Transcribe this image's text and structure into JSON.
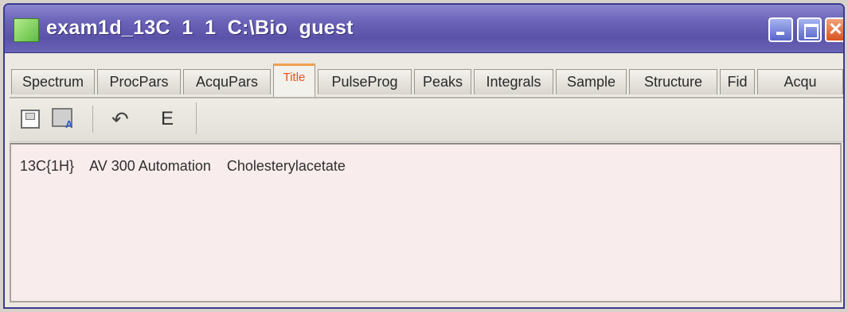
{
  "window": {
    "title": "exam1d_13C  1  1  C:\\Bio  guest",
    "buttons": {
      "minimize": "minimize-icon",
      "maximize": "maximize-icon",
      "close": "close-icon"
    },
    "colors": {
      "titlebar": "#6a63b8",
      "close": "#d8531f",
      "active_tab": "#e8531f"
    }
  },
  "tabs": [
    {
      "label": "Spectrum"
    },
    {
      "label": "ProcPars"
    },
    {
      "label": "AcquPars"
    },
    {
      "label": "Title"
    },
    {
      "label": "PulseProg"
    },
    {
      "label": "Peaks"
    },
    {
      "label": "Integrals"
    },
    {
      "label": "Sample"
    },
    {
      "label": "Structure"
    },
    {
      "label": "Fid"
    },
    {
      "label": "Acqu"
    }
  ],
  "toolbar": {
    "icons": [
      "save-icon",
      "save-as-icon",
      "undo-icon",
      "edit-icon"
    ],
    "edit_label": "E"
  },
  "content": {
    "title_text": "13C{1H}    AV 300 Automation    Cholesterylacetate"
  }
}
